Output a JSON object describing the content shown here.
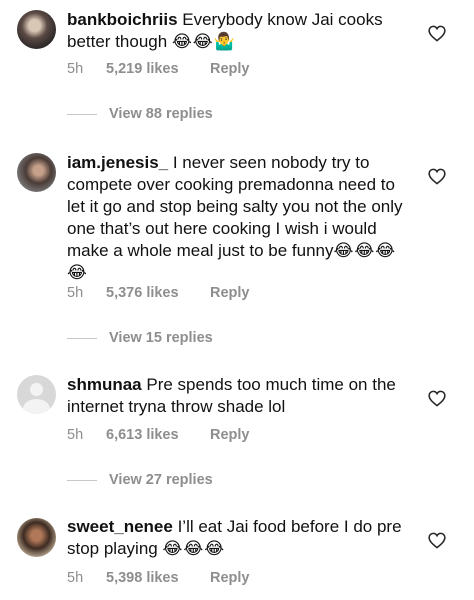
{
  "comments": [
    {
      "username": "bankboichriis",
      "text": "Everybody know Jai cooks better though",
      "emojis": "😂😂🤷‍♂️",
      "time": "5h",
      "likes": "5,219 likes",
      "reply": "Reply",
      "view_replies": "View 88 replies"
    },
    {
      "username": "iam.jenesis_",
      "text": "I never seen nobody try to compete over cooking premadonna need to let it go and stop being salty you not the only one that’s out here cooking I wish i would make a whole meal just to be funny",
      "emojis": "😂😂😂😂",
      "time": "5h",
      "likes": "5,376 likes",
      "reply": "Reply",
      "view_replies": "View 15 replies"
    },
    {
      "username": "shmunaa",
      "text": "Pre spends too much time on the internet tryna throw shade lol",
      "emojis": "",
      "time": "5h",
      "likes": "6,613 likes",
      "reply": "Reply",
      "view_replies": "View 27 replies"
    },
    {
      "username": "sweet_nenee",
      "text": "I’ll eat Jai food before I do pre stop playing",
      "emojis": "😂😂😂",
      "time": "5h",
      "likes": "5,398 likes",
      "reply": "Reply"
    }
  ]
}
